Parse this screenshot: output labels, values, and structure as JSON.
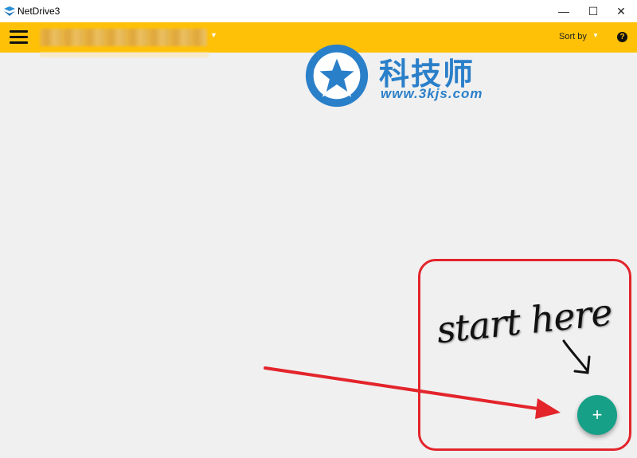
{
  "window": {
    "title": "NetDrive3",
    "minimize_glyph": "—",
    "maximize_glyph": "☐",
    "close_glyph": "✕"
  },
  "toolbar": {
    "menu_icon": "hamburger-icon",
    "account_caret": "▼",
    "sort_label": "Sort by",
    "sort_caret": "▼",
    "help_glyph": "?"
  },
  "watermark": {
    "brand_text": "科技师",
    "url_text": "www.3kjs.com"
  },
  "annotation": {
    "text": "start here"
  },
  "fab": {
    "glyph": "+"
  },
  "colors": {
    "toolbar": "#ffc107",
    "fab": "#17a088",
    "annotation_red": "#e3242b",
    "watermark_blue": "#2a7fc9"
  }
}
